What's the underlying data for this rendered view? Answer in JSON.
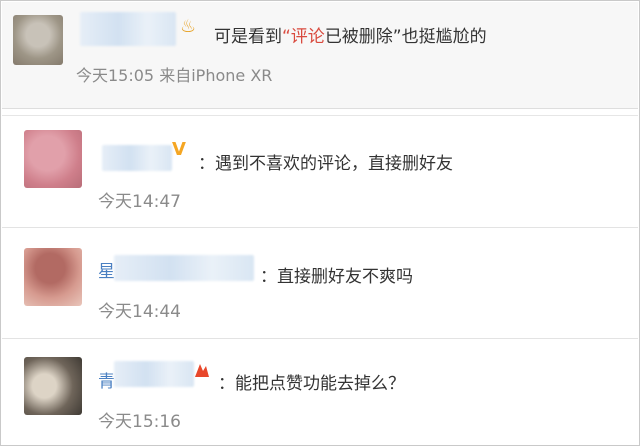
{
  "comments": [
    {
      "name_visible": "",
      "badge_icon": "star-badge-icon",
      "text_before": "可是看到",
      "text_quoted": "“评论",
      "text_after": "已被删除”也挺尴尬的",
      "time": "今天15:05",
      "source": "来自iPhone XR"
    },
    {
      "name_visible": "",
      "badge_icon": "v-badge-icon",
      "badge_glyph": "V",
      "text": "：遇到不喜欢的评论，直接删好友",
      "time": "今天14:47"
    },
    {
      "name_visible": "星",
      "text": "：直接删好友不爽吗",
      "time": "今天14:44"
    },
    {
      "name_visible": "青",
      "badge_icon": "red-crown-icon",
      "text": "：能把点赞功能去掉么？",
      "time": "今天15:16"
    }
  ],
  "colors": {
    "link_blue": "#4a80c2",
    "quote_red": "#d94a3e",
    "meta_gray": "#8a8a8a",
    "text_dark": "#333333"
  }
}
